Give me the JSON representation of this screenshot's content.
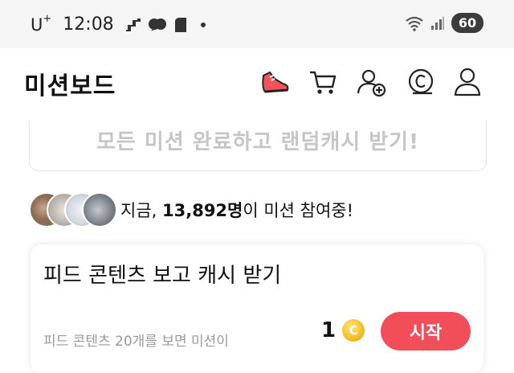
{
  "status_bar": {
    "carrier": "U",
    "carrier_sup": "+",
    "time": "12:08",
    "battery": "60"
  },
  "header": {
    "title": "미션보드",
    "icons": [
      "sneaker-icon",
      "cart-icon",
      "add-friend-icon",
      "cash-coin-icon",
      "profile-icon"
    ]
  },
  "complete_banner": {
    "text": "모든 미션 완료하고 랜덤캐시 받기!"
  },
  "participants": {
    "prefix": "지금, ",
    "count": "13,892명",
    "suffix": "이 미션 참여중!"
  },
  "mission": {
    "title": "피드 콘텐츠 보고 캐시 받기",
    "description": "피드 콘텐츠 20개를 보면 미션이",
    "reward": "1",
    "coin_symbol": "C",
    "button": "시작"
  },
  "colors": {
    "accent": "#f24e5a",
    "coin": "#f5c22b",
    "muted_text": "#c6c6c6"
  }
}
